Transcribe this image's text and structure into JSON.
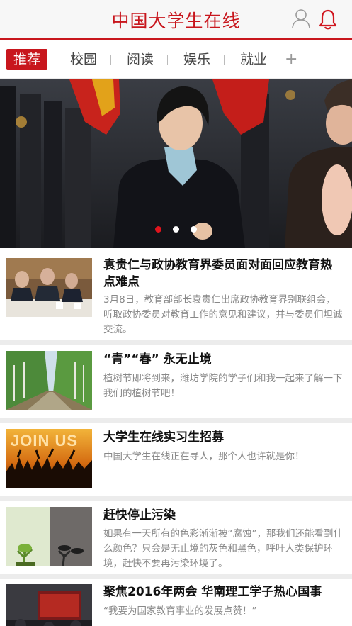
{
  "header": {
    "title": "中国大学生在线",
    "user_icon": "user-icon",
    "bell_icon": "bell-icon",
    "accent": "#c8161d"
  },
  "tabs": [
    {
      "label": "推荐",
      "active": true
    },
    {
      "label": "校园",
      "active": false
    },
    {
      "label": "阅读",
      "active": false
    },
    {
      "label": "娱乐",
      "active": false
    },
    {
      "label": "就业",
      "active": false
    }
  ],
  "tab_more_label": "+",
  "banner": {
    "slide_count": 3,
    "active_slide": 1
  },
  "news": [
    {
      "title": "袁贵仁与政协教育界委员面对面回应教育热点难点",
      "summary": "3月8日，教育部部长袁贵仁出席政协教育界别联组会，听取政协委员对教育工作的意见和建议，并与委员们坦诚交流。"
    },
    {
      "title": "“青”“春” 永无止境",
      "summary": "植树节即将到来，潍坊学院的学子们和我一起来了解一下我们的植树节吧！"
    },
    {
      "title": "大学生在线实习生招募",
      "summary": " 中国大学生在线正在寻人，那个人也许就是你！",
      "thumb_text": "JOIN US"
    },
    {
      "title": "赶快停止污染",
      "summary": "如果有一天所有的色彩渐渐被“腐蚀”，那我们还能看到什么颜色？只会是无止境的灰色和黑色，呼吁人类保护环境，赶快不要再污染环境了。"
    },
    {
      "title": "聚焦2016年两会 华南理工学子热心国事",
      "summary": "“我要为国家教育事业的发展点赞！”"
    }
  ]
}
